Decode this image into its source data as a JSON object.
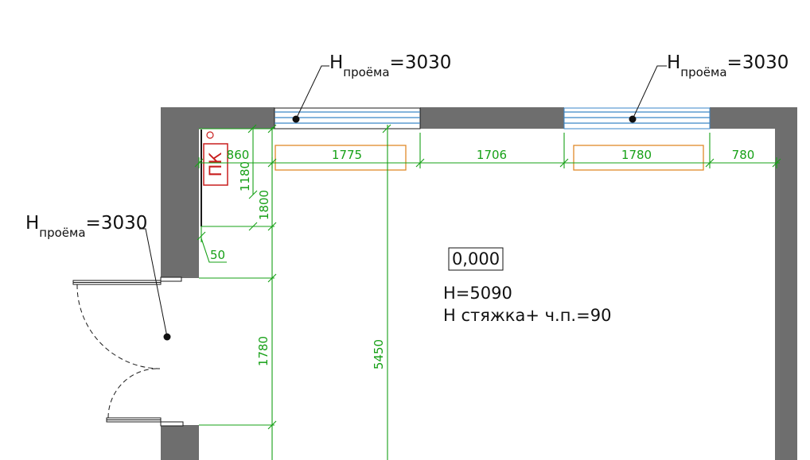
{
  "annotations": {
    "opening_top_left": {
      "main": "H",
      "sub": "проёма",
      "value": "=3030"
    },
    "opening_top_right": {
      "main": "H",
      "sub": "проёма",
      "value": "=3030"
    },
    "opening_door": {
      "main": "H",
      "sub": "проёма",
      "value": "=3030"
    }
  },
  "room": {
    "level": "0,000",
    "height": "H=5090",
    "screed": "H стяжка+ ч.п.=90"
  },
  "fire_cabinet": {
    "label": "ПК"
  },
  "dimensions": {
    "d860": "860",
    "d1775": "1775",
    "d1706": "1706",
    "d1780_top": "1780",
    "d780": "780",
    "d1180": "1180",
    "d1800": "1800",
    "d50": "50",
    "d1780_left": "1780",
    "d5450": "5450"
  },
  "colors": {
    "wall": "#6e6e6e",
    "dimension": "#16a016",
    "window": "#3a86c8",
    "radiator": "#e08a2a",
    "fire_cabinet": "#c81e1e"
  }
}
